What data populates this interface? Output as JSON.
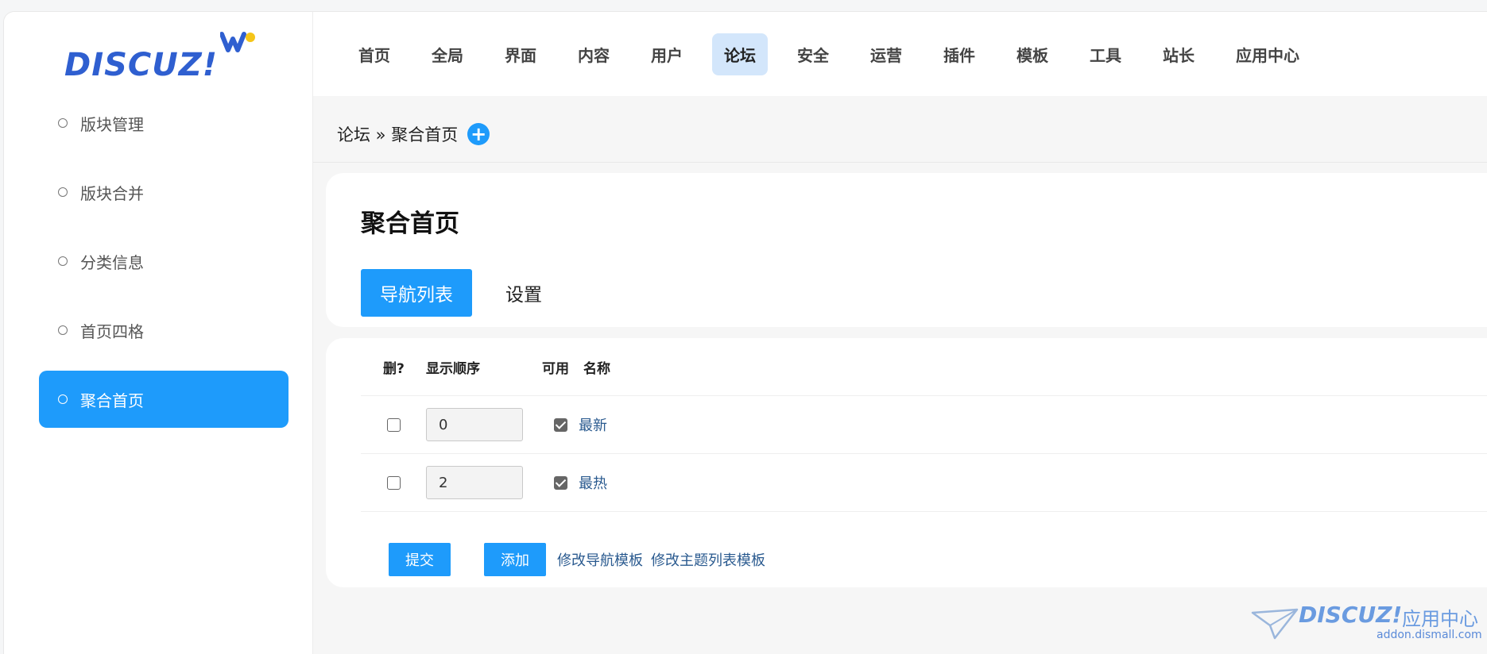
{
  "logo": {
    "text": "DISCUZ!"
  },
  "sidebar": {
    "items": [
      {
        "label": "版块管理"
      },
      {
        "label": "版块合并"
      },
      {
        "label": "分类信息"
      },
      {
        "label": "首页四格"
      },
      {
        "label": "聚合首页"
      }
    ],
    "active_index": 4
  },
  "topnav": {
    "items": [
      {
        "label": "首页"
      },
      {
        "label": "全局"
      },
      {
        "label": "界面"
      },
      {
        "label": "内容"
      },
      {
        "label": "用户"
      },
      {
        "label": "论坛"
      },
      {
        "label": "安全"
      },
      {
        "label": "运营"
      },
      {
        "label": "插件"
      },
      {
        "label": "模板"
      },
      {
        "label": "工具"
      },
      {
        "label": "站长"
      },
      {
        "label": "应用中心"
      }
    ],
    "active_index": 5
  },
  "breadcrumb": {
    "text": "论坛 » 聚合首页",
    "plus": "+"
  },
  "page": {
    "title": "聚合首页",
    "tabs": [
      {
        "label": "导航列表"
      },
      {
        "label": "设置"
      }
    ]
  },
  "table": {
    "headers": {
      "del": "删?",
      "order": "显示顺序",
      "enabled": "可用",
      "name": "名称"
    },
    "rows": [
      {
        "order": "0",
        "enabled": true,
        "name": "最新"
      },
      {
        "order": "2",
        "enabled": true,
        "name": "最热"
      }
    ]
  },
  "actions": {
    "submit": "提交",
    "add": "添加",
    "edit_nav_template": "修改导航模板",
    "edit_thread_template": "修改主题列表模板"
  },
  "watermark": {
    "logo": "DISCUZ!",
    "cn": "应用中心",
    "url": "addon.dismall.com"
  },
  "colors": {
    "accent": "#1e9bfb",
    "link": "#2a5a8f",
    "nav_active_bg": "#d3e6fb"
  }
}
